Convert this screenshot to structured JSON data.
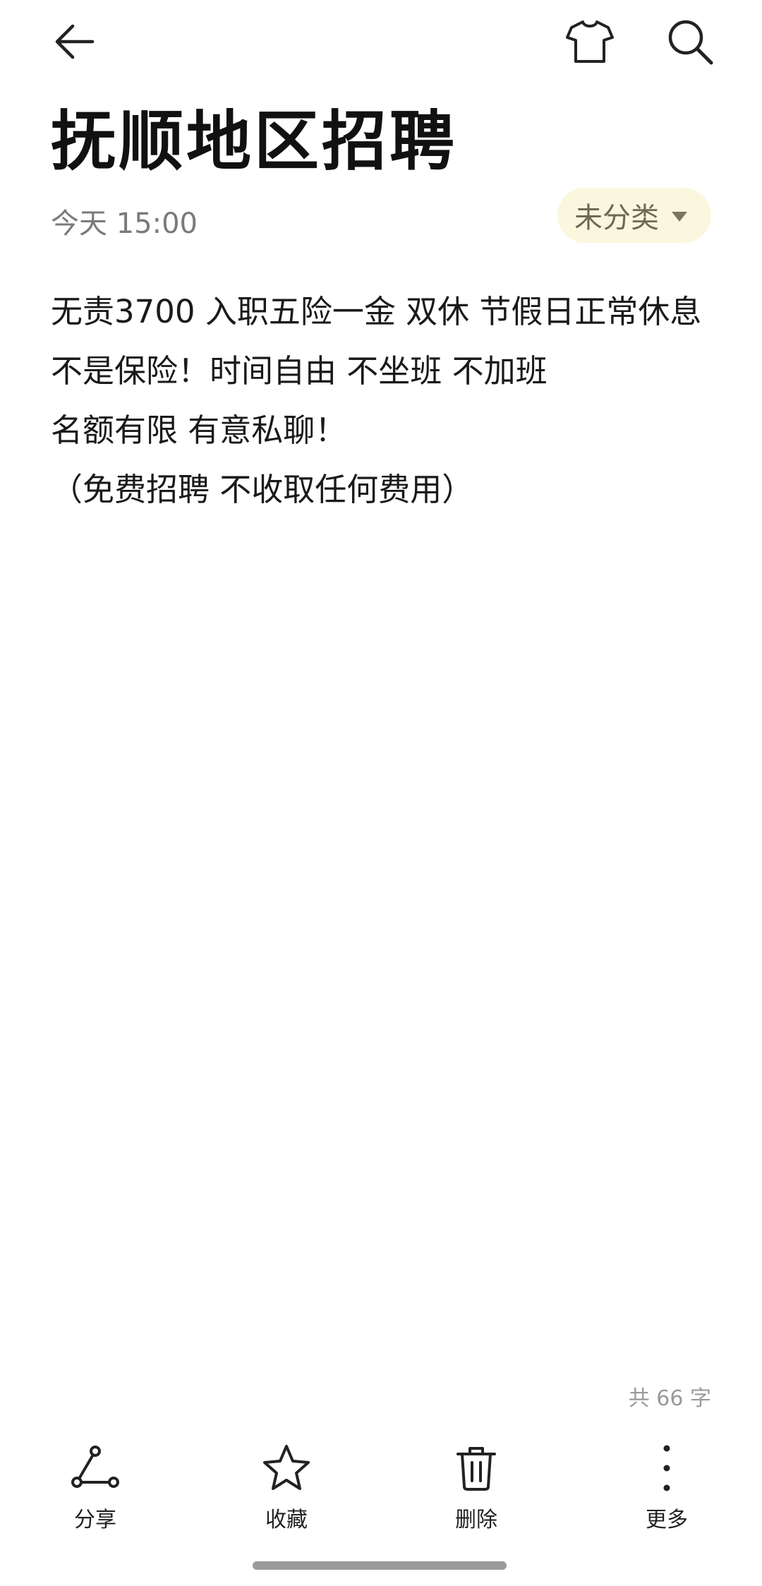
{
  "note": {
    "title": "抚顺地区招聘",
    "date": "今天 15:00",
    "category": "未分类",
    "body_lines": [
      "无责3700 入职五险一金 双休 节假日正常休息",
      "不是保险！时间自由 不坐班 不加班",
      "名额有限 有意私聊！",
      "（免费招聘 不收取任何费用）"
    ],
    "word_count": "共 66 字"
  },
  "toolbar": {
    "share_label": "分享",
    "favorite_label": "收藏",
    "delete_label": "删除",
    "more_label": "更多"
  },
  "icons": {
    "back": "back-arrow-icon",
    "theme": "shirt-icon",
    "search": "search-icon",
    "share": "share-icon",
    "favorite": "star-icon",
    "delete": "trash-icon",
    "more": "more-vertical-icon"
  },
  "colors": {
    "chip_background": "#fbf7df",
    "chip_text": "#6e6a55",
    "meta_text": "#7a7a7a"
  }
}
